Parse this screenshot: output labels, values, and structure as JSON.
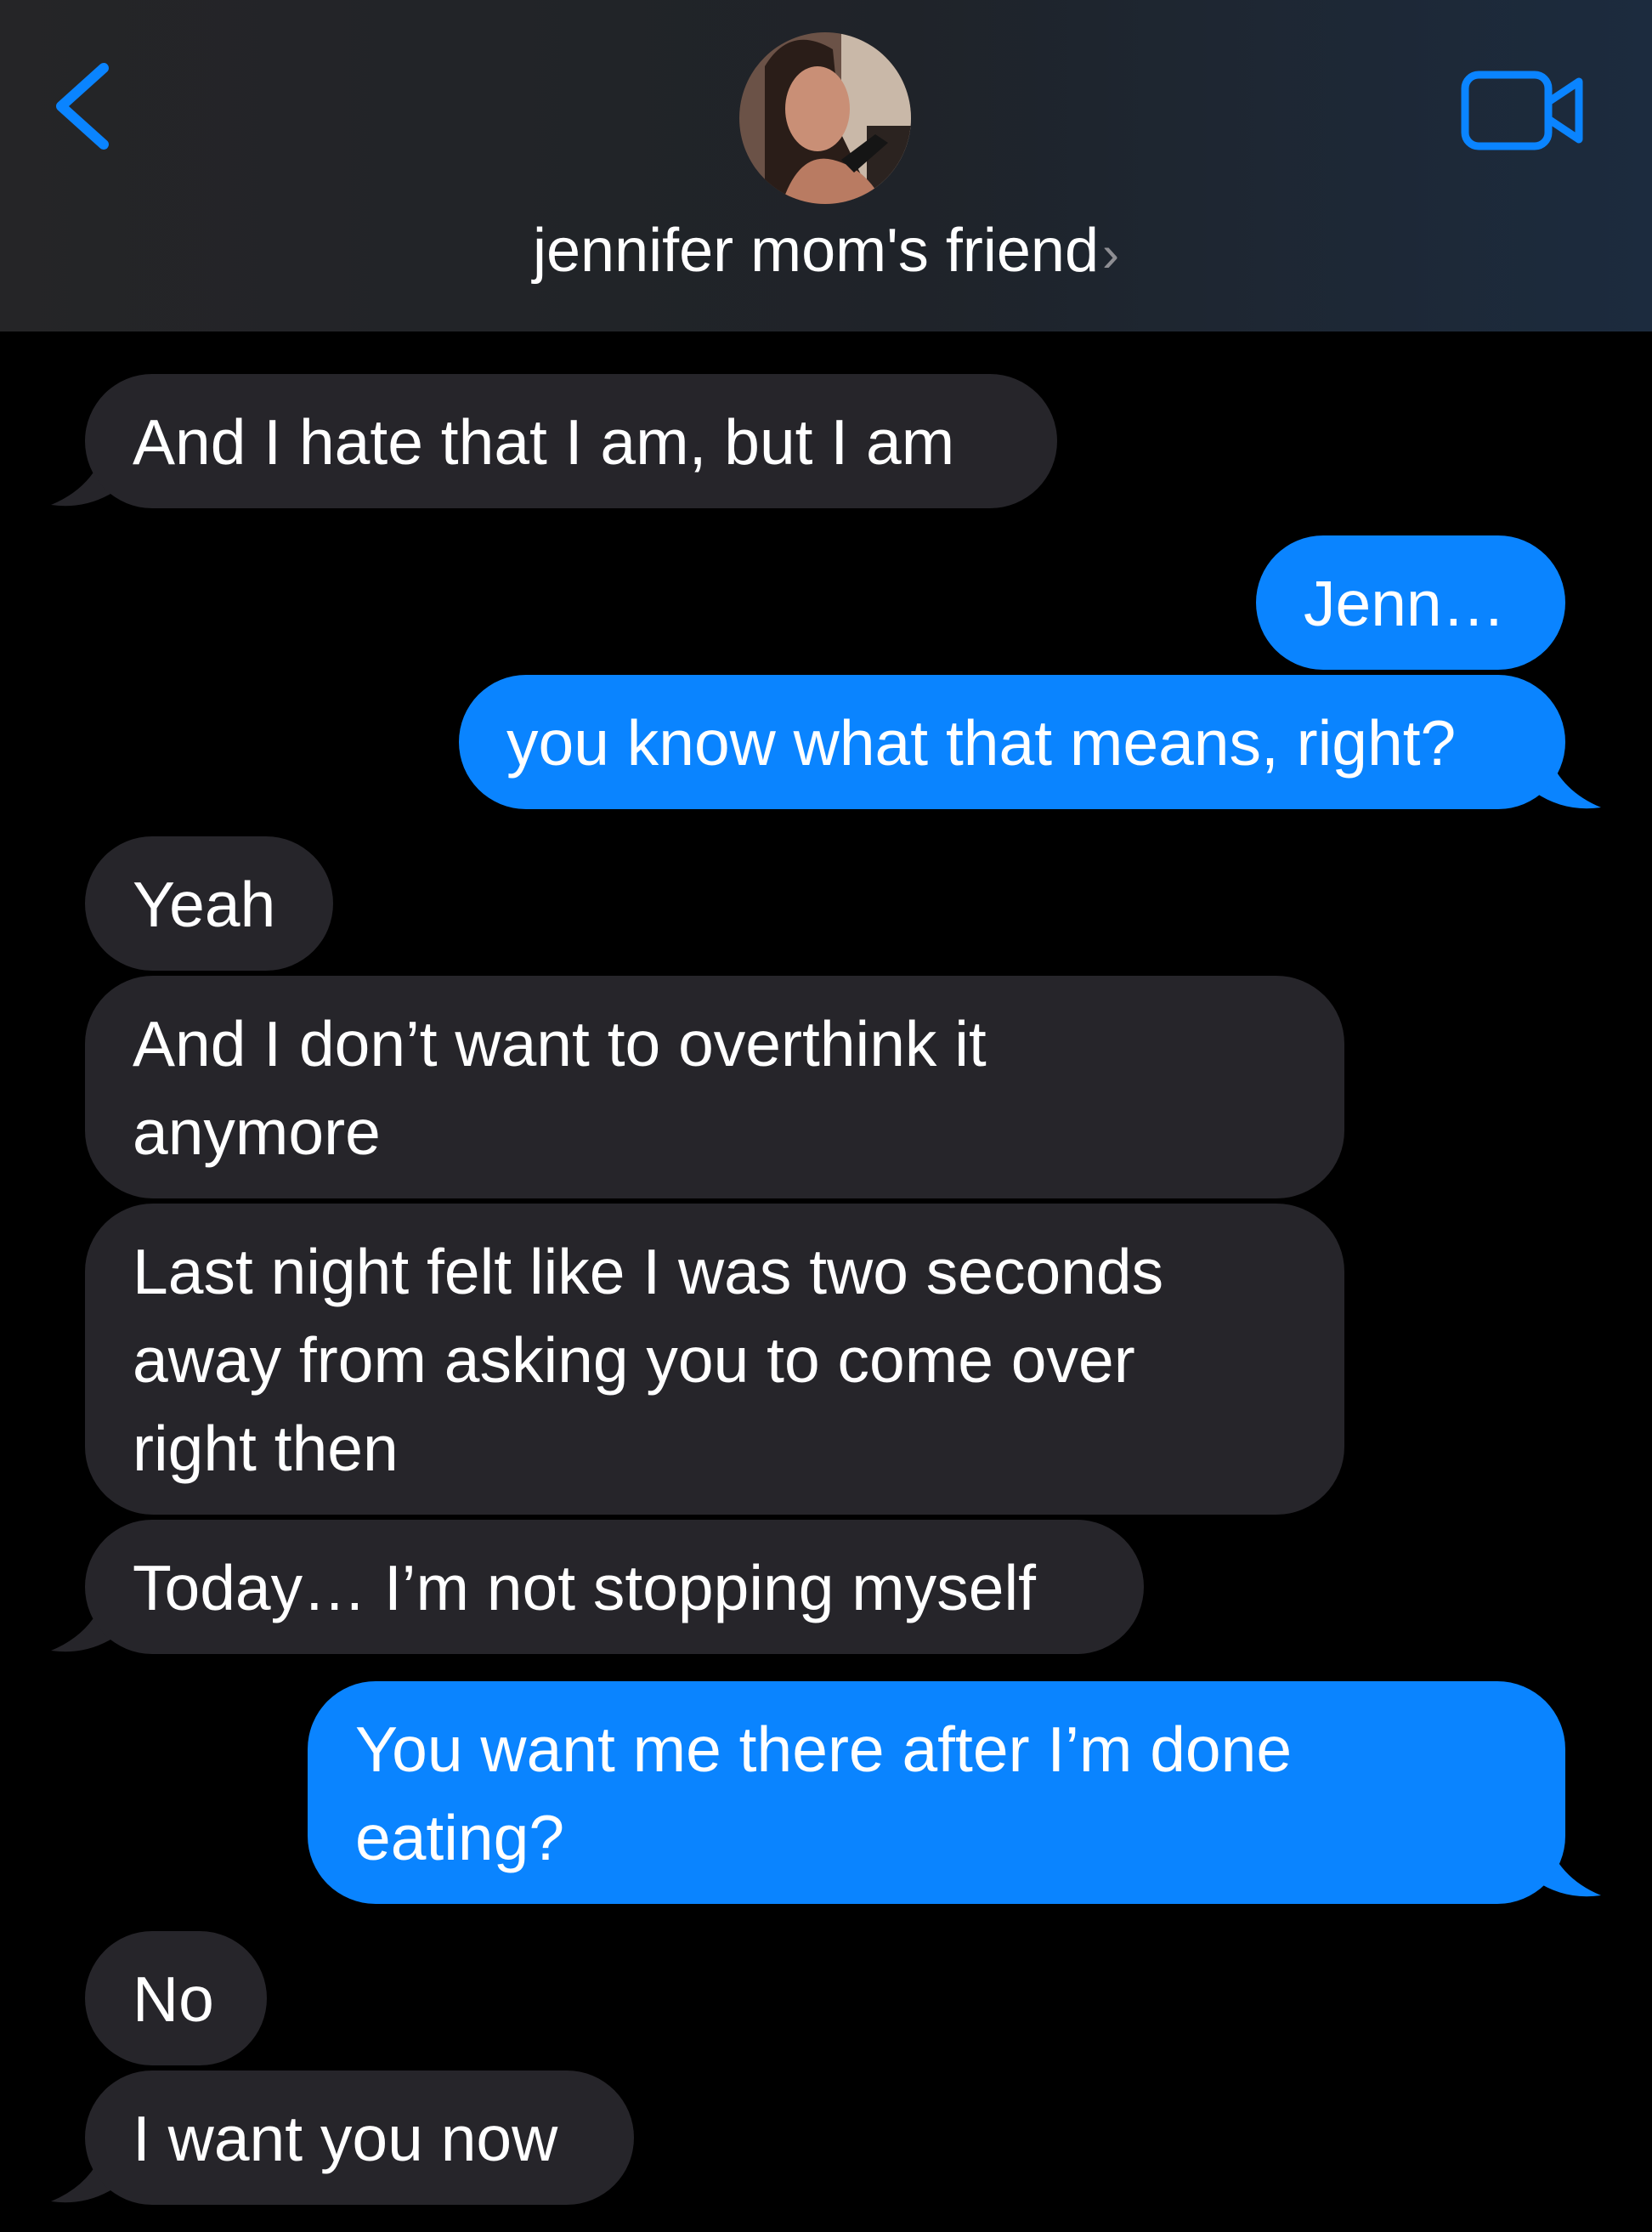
{
  "header": {
    "contact_name": "jennifer mom's friend",
    "chevron": "›",
    "back_icon": "chevron-left-icon",
    "video_icon": "video-camera-icon",
    "accent_color": "#0a84ff"
  },
  "messages": [
    {
      "from": "them",
      "text": "And I hate that I am, but I am"
    },
    {
      "from": "me",
      "text": "Jenn…"
    },
    {
      "from": "me",
      "text": "you know what that means, right?"
    },
    {
      "from": "them",
      "text": "Yeah"
    },
    {
      "from": "them",
      "lines": [
        "And I don’t want to overthink it",
        "anymore"
      ]
    },
    {
      "from": "them",
      "lines": [
        "Last night felt like I was two seconds",
        "away from asking you to come over",
        "right then"
      ]
    },
    {
      "from": "them",
      "text": "Today… I’m not stopping myself"
    },
    {
      "from": "me",
      "lines": [
        "You want me there after I’m done",
        "eating?"
      ]
    },
    {
      "from": "them",
      "text": "No"
    },
    {
      "from": "them",
      "text": "I want you now"
    }
  ],
  "colors": {
    "incoming_bubble": "#26252a",
    "outgoing_bubble": "#0a84ff",
    "background": "#000000"
  }
}
